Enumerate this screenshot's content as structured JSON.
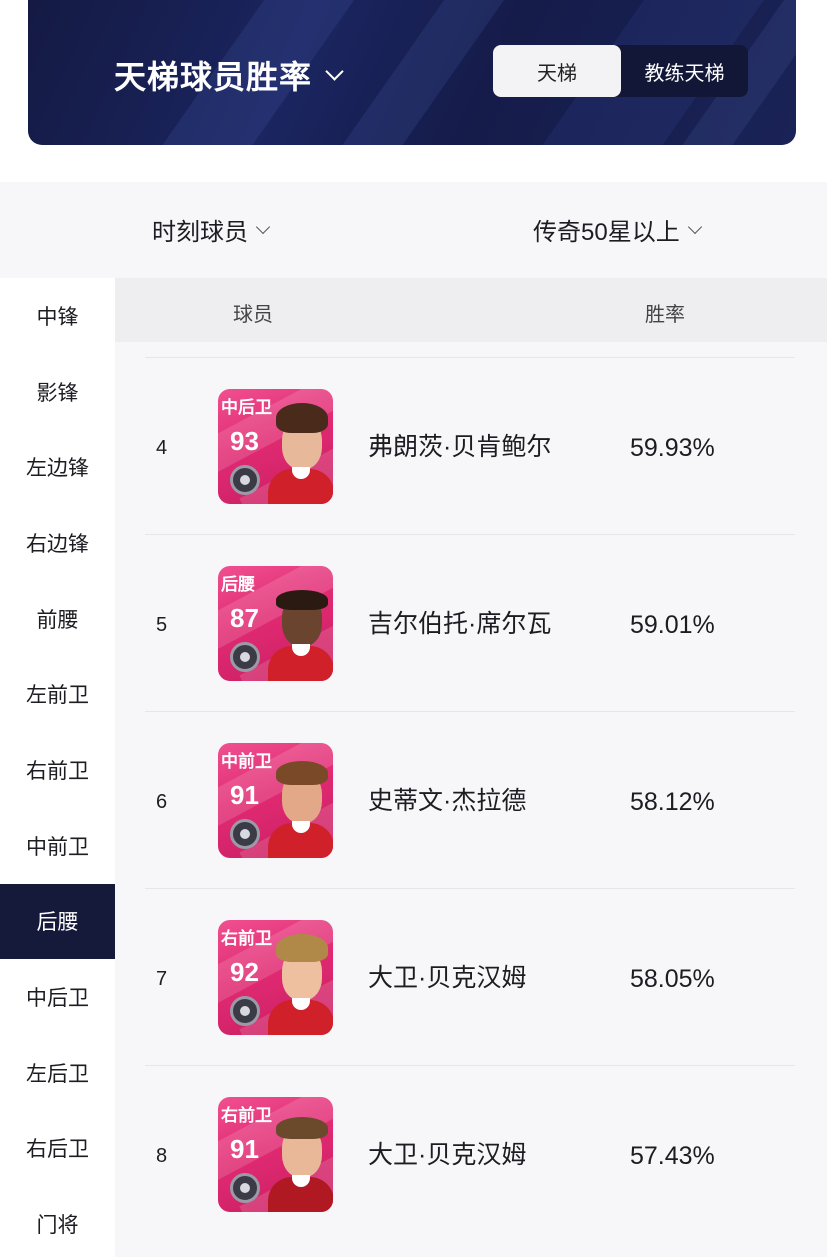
{
  "header": {
    "title": "天梯球员胜率",
    "tabs": [
      {
        "label": "天梯",
        "active": true
      },
      {
        "label": "教练天梯",
        "active": false
      }
    ]
  },
  "filters": {
    "player_type": "时刻球员",
    "level": "传奇50星以上"
  },
  "sidebar": {
    "items": [
      {
        "label": "中锋",
        "active": false
      },
      {
        "label": "影锋",
        "active": false
      },
      {
        "label": "左边锋",
        "active": false
      },
      {
        "label": "右边锋",
        "active": false
      },
      {
        "label": "前腰",
        "active": false
      },
      {
        "label": "左前卫",
        "active": false
      },
      {
        "label": "右前卫",
        "active": false
      },
      {
        "label": "中前卫",
        "active": false
      },
      {
        "label": "后腰",
        "active": true
      },
      {
        "label": "中后卫",
        "active": false
      },
      {
        "label": "左后卫",
        "active": false
      },
      {
        "label": "右后卫",
        "active": false
      },
      {
        "label": "门将",
        "active": false
      }
    ]
  },
  "table": {
    "columns": [
      "球员",
      "胜率"
    ],
    "rows": [
      {
        "rank": "4",
        "card_position": "中后卫",
        "rating": "93",
        "name": "弗朗茨·贝肯鲍尔",
        "win_rate": "59.93%"
      },
      {
        "rank": "5",
        "card_position": "后腰",
        "rating": "87",
        "name": "吉尔伯托·席尔瓦",
        "win_rate": "59.01%"
      },
      {
        "rank": "6",
        "card_position": "中前卫",
        "rating": "91",
        "name": "史蒂文·杰拉德",
        "win_rate": "58.12%"
      },
      {
        "rank": "7",
        "card_position": "右前卫",
        "rating": "92",
        "name": "大卫·贝克汉姆",
        "win_rate": "58.05%"
      },
      {
        "rank": "8",
        "card_position": "右前卫",
        "rating": "91",
        "name": "大卫·贝克汉姆",
        "win_rate": "57.43%"
      }
    ]
  },
  "colors": {
    "banner": "#1b2560",
    "active_sidebar": "#151a3a",
    "card_pink": "#e02a72"
  }
}
